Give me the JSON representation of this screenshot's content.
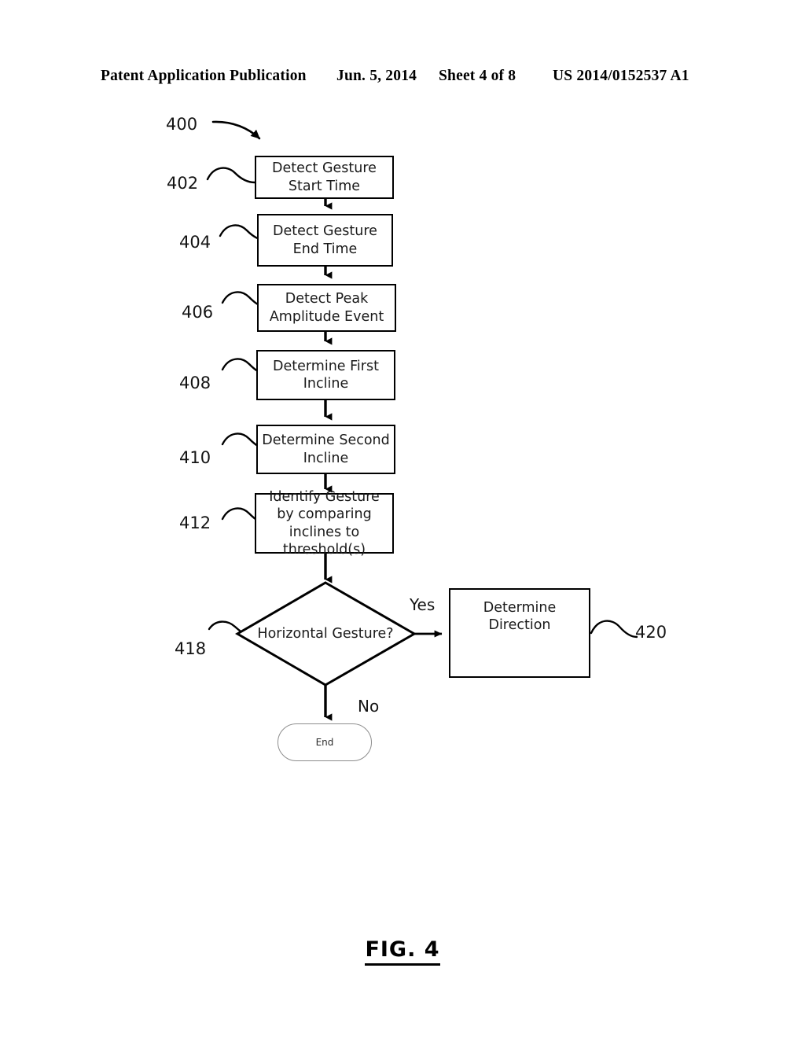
{
  "header": {
    "publication": "Patent Application Publication",
    "date": "Jun. 5, 2014",
    "sheet": "Sheet 4 of 8",
    "patent_number": "US 2014/0152537 A1"
  },
  "figure": {
    "caption": "FIG. 4",
    "diagram_ref": "400"
  },
  "nodes": [
    {
      "ref": "402",
      "type": "process",
      "text": "Detect Gesture Start Time"
    },
    {
      "ref": "404",
      "type": "process",
      "text": "Detect Gesture End Time"
    },
    {
      "ref": "406",
      "type": "process",
      "text": "Detect Peak Amplitude Event"
    },
    {
      "ref": "408",
      "type": "process",
      "text": "Determine First Incline"
    },
    {
      "ref": "410",
      "type": "process",
      "text": "Determine Second Incline"
    },
    {
      "ref": "412",
      "type": "process",
      "text": "Identify Gesture by comparing inclines to threshold(s)"
    },
    {
      "ref": "418",
      "type": "decision",
      "text": "Horizontal Gesture?"
    },
    {
      "ref": "420",
      "type": "process",
      "text": "Determine Direction"
    },
    {
      "ref": "",
      "type": "terminator",
      "text": "End"
    }
  ],
  "branches": {
    "yes_label": "Yes",
    "no_label": "No"
  },
  "colors": {
    "line": "#000000",
    "terminator_border": "#8d8d8d",
    "background": "#ffffff",
    "text": "#141414"
  }
}
